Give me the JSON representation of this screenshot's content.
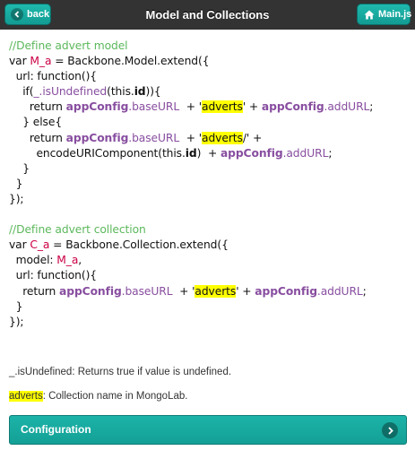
{
  "header": {
    "title": "Model and Collections",
    "back_label": "back",
    "main_label": "Main.js"
  },
  "code": {
    "l1_comment": "//Define advert model",
    "l2_a": "var ",
    "l2_var": "M_a",
    "l2_b": " = Backbone.Model.extend({",
    "l3": "  url: function(){",
    "l4_a": "    if(",
    "l4_fn": "_.isUndefined",
    "l4_b": "(this.",
    "l4_id": "id",
    "l4_c": ")){",
    "l5_a": "      return ",
    "l5_cfg": "appConfig",
    "l5_p1": ".baseURL",
    "l5_b": "  + '",
    "l5_hl": "adverts",
    "l5_c": "' + ",
    "l5_cfg2": "appConfig",
    "l5_p2": ".addURL",
    "l5_d": ";",
    "l6": "    } else{",
    "l7_a": "      return ",
    "l7_cfg": "appConfig",
    "l7_p1": ".baseURL",
    "l7_b": "  + '",
    "l7_hl": "adverts",
    "l7_c": "/' +",
    "l8_a": "        encodeURIComponent(this.",
    "l8_id": "id",
    "l8_b": ")  + ",
    "l8_cfg": "appConfig",
    "l8_p": ".addURL",
    "l8_c": ";",
    "l9": "    }",
    "l10": "  }",
    "l11": "});",
    "l13_comment": "//Define advert collection",
    "l14_a": "var ",
    "l14_var": "C_a",
    "l14_b": " = Backbone.Collection.extend({",
    "l15_a": "  model: ",
    "l15_var": "M_a",
    "l15_b": ",",
    "l16": "  url: function(){",
    "l17_a": "    return ",
    "l17_cfg": "appConfig",
    "l17_p1": ".baseURL",
    "l17_b": "  + '",
    "l17_hl": "adverts",
    "l17_c": "' + ",
    "l17_cfg2": "appConfig",
    "l17_p2": ".addURL",
    "l17_d": ";",
    "l18": "  }",
    "l19": "});"
  },
  "notes": {
    "n1": "_.isUndefined: Returns true if value is undefined.",
    "n2_hl": "adverts",
    "n2_rest": ": Collection name in MongoLab."
  },
  "config_button": {
    "label": "Configuration"
  },
  "colors": {
    "header_bg": "#333333",
    "accent_teal": "#1fb9ad",
    "comment_green": "#5cb85c",
    "variable_red": "#cc0044",
    "config_purple": "#884ea0",
    "highlight_yellow": "#ffff00"
  },
  "icons": {
    "back": "chevron-left-icon",
    "main": "home-icon",
    "config": "chevron-right-icon"
  }
}
